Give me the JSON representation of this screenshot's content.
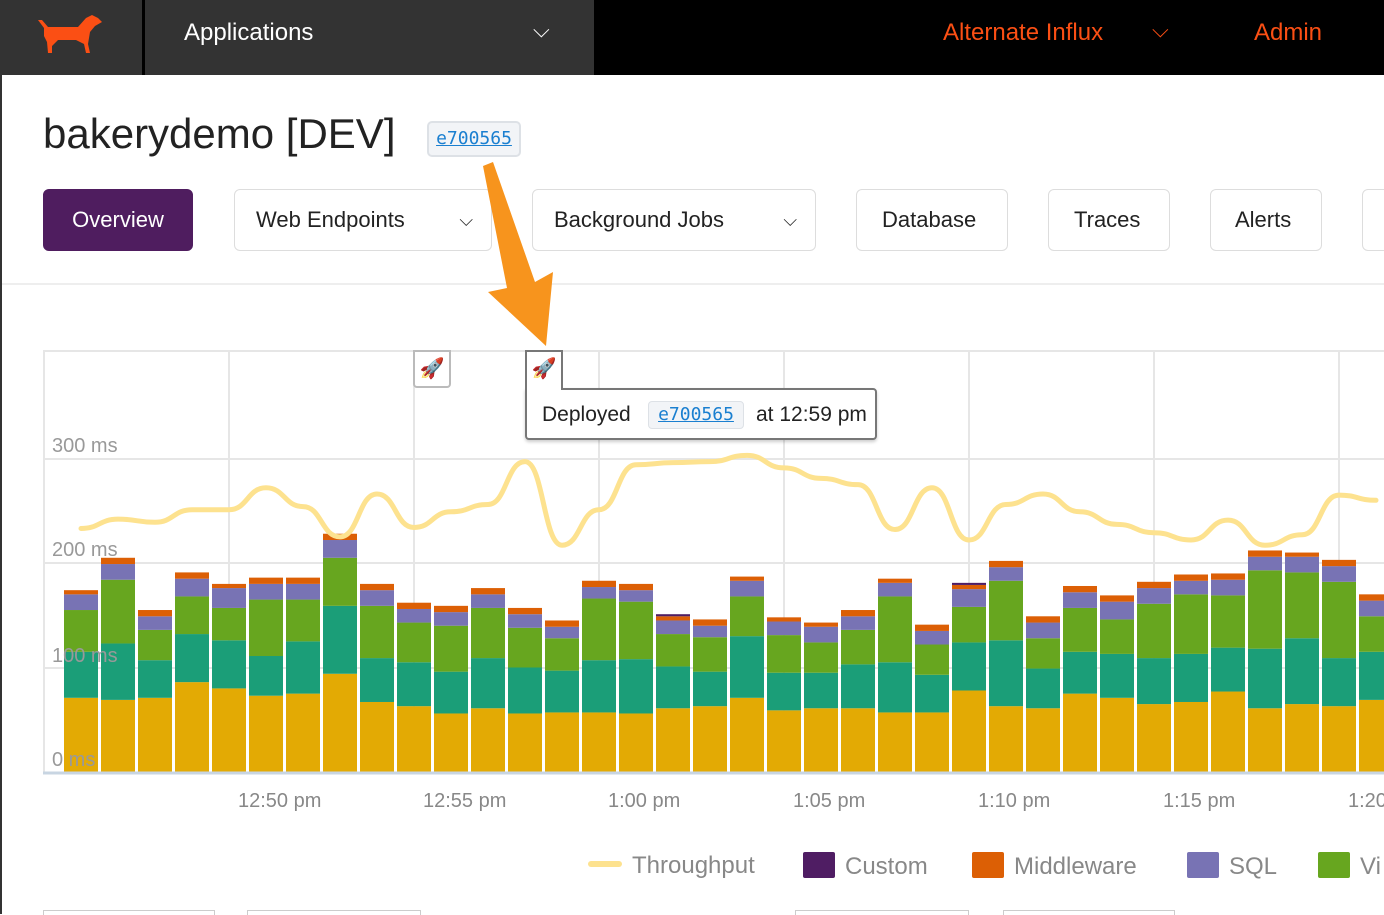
{
  "nav": {
    "apps_label": "Applications",
    "env_label": "Alternate Influx",
    "admin_label": "Admin",
    "brand_color": "#fb4f14",
    "logo": "dog-logo"
  },
  "app": {
    "title": "bakerydemo [DEV]",
    "sha": "e700565"
  },
  "tabs": [
    {
      "label": "Overview",
      "active": true
    },
    {
      "label": "Web Endpoints",
      "dropdown": true
    },
    {
      "label": "Background Jobs",
      "dropdown": true
    },
    {
      "label": "Database"
    },
    {
      "label": "Traces"
    },
    {
      "label": "Alerts"
    }
  ],
  "tooltip": {
    "prefix": "Deployed",
    "sha": "e700565",
    "suffix": "at 12:59 pm"
  },
  "chart_data": {
    "type": "bar",
    "stacked": true,
    "ylabels": [
      "300 ms",
      "200 ms",
      "100 ms",
      "0 ms"
    ],
    "ylim": [
      0,
      400
    ],
    "xticks": [
      "12:50 pm",
      "12:55 pm",
      "1:00 pm",
      "1:05 pm",
      "1:10 pm",
      "1:15 pm",
      "1:20"
    ],
    "grid": true,
    "legend_position": "bottom",
    "legend": [
      "Throughput",
      "Custom",
      "Middleware",
      "SQL",
      "Vi"
    ],
    "series": [
      {
        "color": "#e3aa04",
        "values": [
          71,
          69,
          71,
          86,
          80,
          73,
          75,
          94,
          67,
          63,
          56,
          61,
          56,
          57,
          57,
          56,
          61,
          63,
          71,
          59,
          61,
          61,
          57,
          57,
          78,
          63,
          61,
          75,
          71,
          65,
          67,
          77,
          61,
          65,
          63,
          69
        ]
      },
      {
        "color": "#1b9e78",
        "values": [
          44,
          54,
          36,
          46,
          46,
          38,
          50,
          65,
          42,
          42,
          40,
          48,
          44,
          40,
          50,
          52,
          40,
          33,
          59,
          36,
          34,
          42,
          48,
          36,
          46,
          63,
          38,
          40,
          42,
          44,
          46,
          42,
          57,
          63,
          46,
          46
        ]
      },
      {
        "name": "Vi",
        "color": "#67a61f",
        "values": [
          40,
          61,
          29,
          36,
          31,
          54,
          40,
          46,
          50,
          38,
          44,
          48,
          38,
          31,
          59,
          55,
          31,
          33,
          38,
          36,
          29,
          33,
          63,
          29,
          34,
          57,
          29,
          42,
          33,
          52,
          57,
          50,
          75,
          63,
          73,
          34
        ]
      },
      {
        "name": "SQL",
        "color": "#7873b4",
        "values": [
          15,
          15,
          13,
          17,
          19,
          15,
          15,
          17,
          15,
          13,
          13,
          13,
          13,
          11,
          11,
          11,
          13,
          11,
          15,
          13,
          15,
          13,
          13,
          13,
          17,
          13,
          15,
          15,
          17,
          15,
          13,
          15,
          13,
          15,
          15,
          15
        ]
      },
      {
        "name": "Middleware",
        "color": "#dc5f05",
        "values": [
          4,
          6,
          6,
          6,
          4,
          6,
          6,
          6,
          6,
          6,
          6,
          6,
          6,
          6,
          6,
          6,
          4,
          6,
          4,
          4,
          4,
          6,
          4,
          6,
          4,
          6,
          6,
          6,
          6,
          6,
          6,
          6,
          6,
          4,
          6,
          6
        ]
      },
      {
        "name": "Custom",
        "color": "#4f1d63",
        "values": [
          0,
          0,
          0,
          0,
          0,
          0,
          0,
          0,
          0,
          0,
          0,
          0,
          0,
          0,
          0,
          0,
          2,
          0,
          0,
          0,
          0,
          0,
          0,
          0,
          2,
          0,
          0,
          0,
          0,
          0,
          0,
          0,
          0,
          0,
          0,
          0
        ]
      }
    ],
    "throughput": {
      "name": "Throughput",
      "color": "#fde28f",
      "values": [
        233,
        242,
        239,
        251,
        251,
        272,
        254,
        225,
        266,
        234,
        249,
        256,
        297,
        217,
        251,
        294,
        296,
        297,
        303,
        291,
        281,
        275,
        232,
        272,
        222,
        256,
        266,
        249,
        237,
        229,
        222,
        241,
        217,
        227,
        265,
        260
      ]
    },
    "deploy_markers": [
      "12:55 pm",
      "12:59 pm"
    ]
  }
}
